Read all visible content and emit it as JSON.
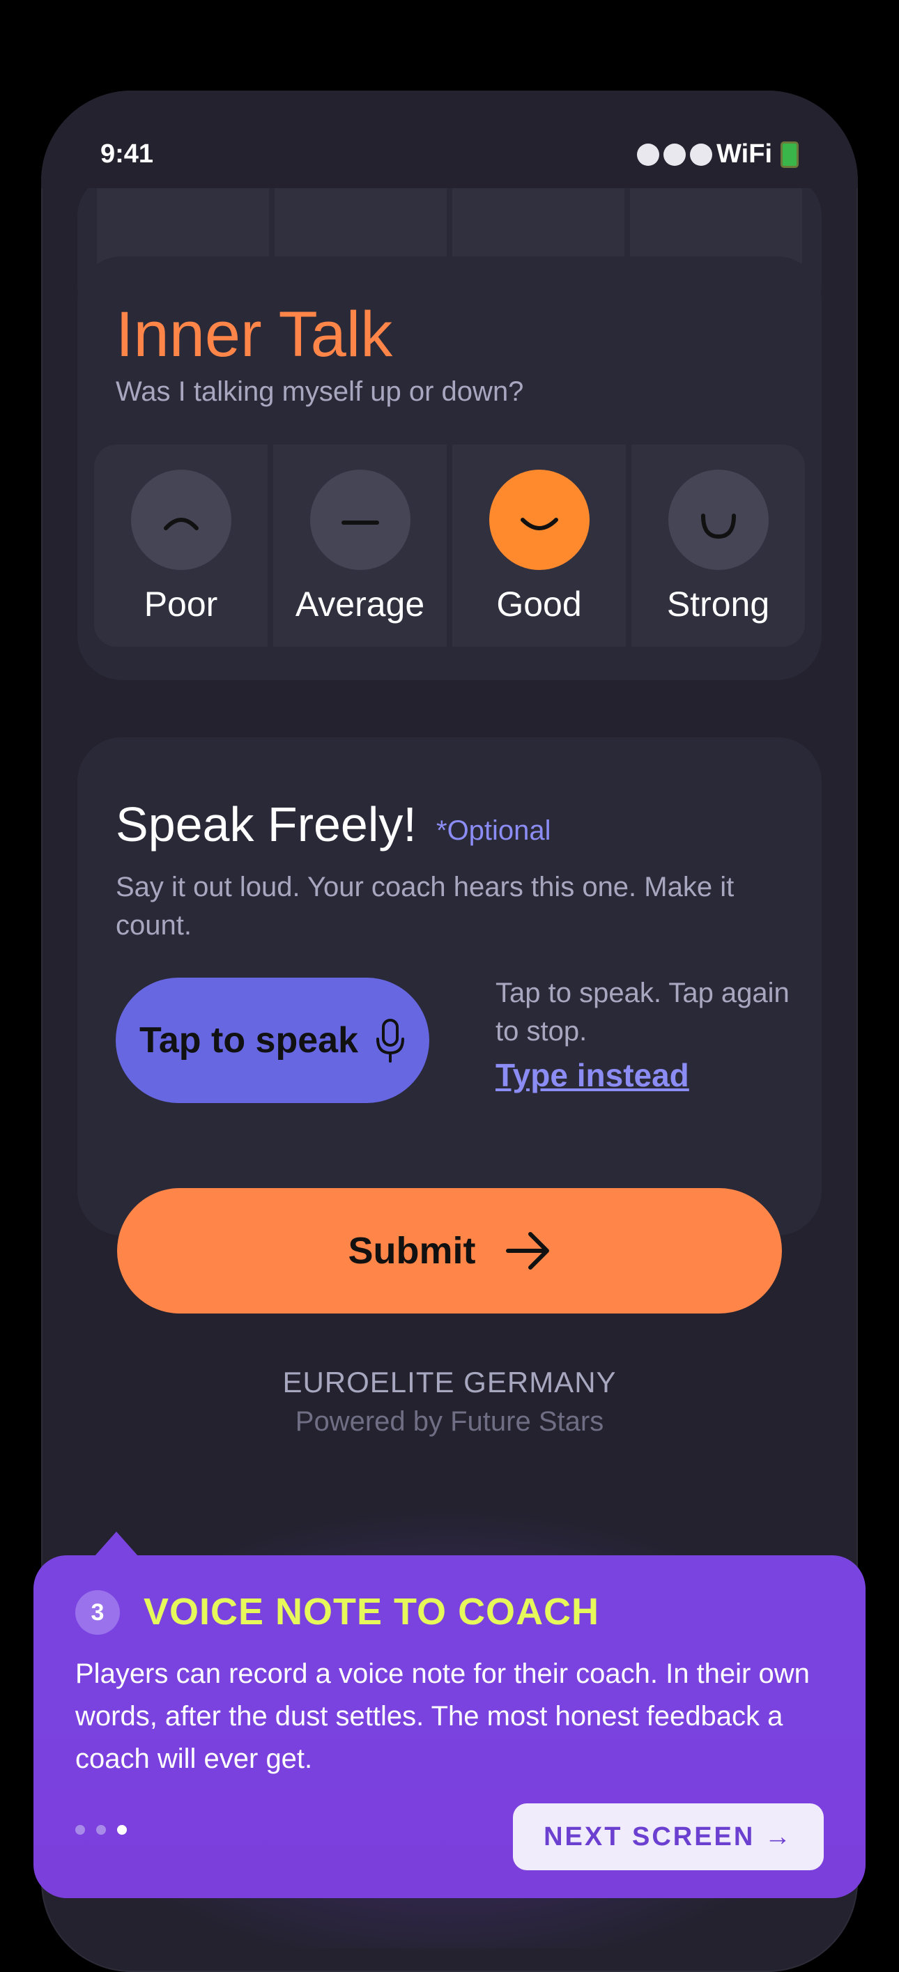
{
  "status": {
    "time": "9:41",
    "network": "WiFi"
  },
  "inner_talk": {
    "title": "Inner Talk",
    "subtitle": "Was I talking myself up or down?",
    "options": [
      {
        "label": "Poor",
        "selected": false
      },
      {
        "label": "Average",
        "selected": false
      },
      {
        "label": "Good",
        "selected": true
      },
      {
        "label": "Strong",
        "selected": false
      }
    ]
  },
  "speak": {
    "title": "Speak Freely!",
    "optional": "*Optional",
    "description": "Say it out loud. Your coach hears this one. Make it count.",
    "button_label": "Tap to speak",
    "hint": "Tap to speak. Tap again to stop.",
    "type_instead": "Type instead"
  },
  "submit_label": "Submit",
  "footer": {
    "org": "EUROELITE GERMANY",
    "powered": "Powered by Future Stars"
  },
  "tooltip": {
    "step": "3",
    "title": "VOICE NOTE TO COACH",
    "body": "Players can record a voice note for their coach. In their own words, after the dust settles. The most honest feedback a coach will ever get.",
    "pages": 3,
    "current_page": 3,
    "next_label": "NEXT SCREEN →"
  },
  "colors": {
    "accent_orange": "#ff8549",
    "accent_purple": "#6767e2",
    "tooltip_bg": "#7a44e0",
    "highlight_yellow": "#e7f95a"
  }
}
